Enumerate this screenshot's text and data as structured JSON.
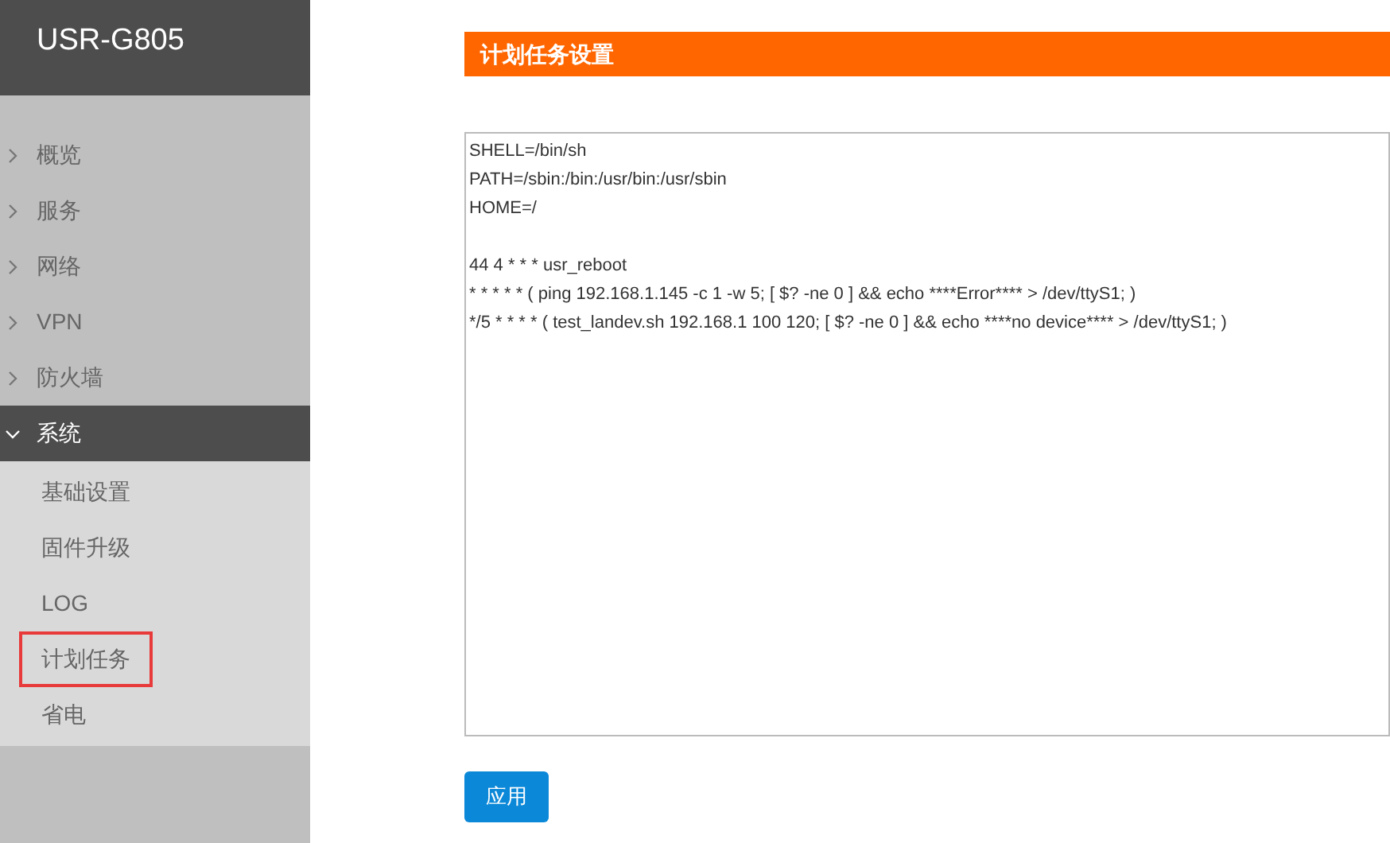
{
  "sidebar": {
    "title": "USR-G805",
    "items": [
      {
        "label": "概览",
        "expanded": false
      },
      {
        "label": "服务",
        "expanded": false
      },
      {
        "label": "网络",
        "expanded": false
      },
      {
        "label": "VPN",
        "expanded": false
      },
      {
        "label": "防火墙",
        "expanded": false
      },
      {
        "label": "系统",
        "expanded": true,
        "children": [
          {
            "label": "基础设置",
            "highlighted": false
          },
          {
            "label": "固件升级",
            "highlighted": false
          },
          {
            "label": "LOG",
            "highlighted": false
          },
          {
            "label": "计划任务",
            "highlighted": true
          },
          {
            "label": "省电",
            "highlighted": false
          }
        ]
      }
    ]
  },
  "section": {
    "title": "计划任务设置",
    "editor_paragraphs": [
      [
        "SHELL=/bin/sh",
        "PATH=/sbin:/bin:/usr/bin:/usr/sbin",
        "HOME=/"
      ],
      [
        "44 4 * * * usr_reboot",
        "* * * * * ( ping 192.168.1.145 -c 1 -w 5; [ $? -ne 0 ] && echo ****Error**** > /dev/ttyS1; )",
        "*/5 * * * * ( test_landev.sh 192.168.1 100 120; [ $? -ne 0 ] && echo ****no device**** > /dev/ttyS1; )"
      ]
    ],
    "apply_button": "应用"
  }
}
